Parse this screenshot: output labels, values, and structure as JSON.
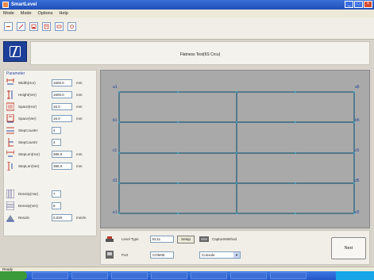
{
  "window": {
    "title": "SmartLevel"
  },
  "menu": [
    "Mode",
    "Mode",
    "Options",
    "Help"
  ],
  "toolbar": {
    "icons": [
      "new-icon",
      "edit-icon",
      "save-icon",
      "export-icon",
      "print-icon",
      "settings-icon"
    ]
  },
  "header": {
    "title": "Flatness Test(6S Crcu)"
  },
  "params": {
    "title": "Parameter",
    "rows": [
      {
        "label": "Width(Hor)",
        "value": "1600.0",
        "unit": "mm"
      },
      {
        "label": "Height(Ver)",
        "value": "1600.0",
        "unit": "mm"
      },
      {
        "label": "Space(Hor)",
        "value": "16.0",
        "unit": "mm"
      },
      {
        "label": "Space(Ver)",
        "value": "16.0",
        "unit": "mm"
      },
      {
        "label": "StepCountH",
        "value": "4",
        "unit": ""
      },
      {
        "label": "StepCountV",
        "value": "4",
        "unit": ""
      },
      {
        "label": "StepLen(Hor)",
        "value": "385.0",
        "unit": "mm"
      },
      {
        "label": "StepLen(Ver)",
        "value": "385.0",
        "unit": "mm"
      },
      {
        "label": "Density(Hor)",
        "value": "7",
        "unit": ""
      },
      {
        "label": "Density(Ver)",
        "value": "8",
        "unit": ""
      },
      {
        "label": "Resoln",
        "value": "0.020",
        "unit": "mm/m"
      }
    ]
  },
  "grid": {
    "left_labels": [
      "a1",
      "b1",
      "c1",
      "d1",
      "e1"
    ],
    "right_labels": [
      "a5",
      "b5",
      "c5",
      "d5",
      "e5"
    ]
  },
  "bottom": {
    "level_type_label": "Level Type",
    "level_type_value": "EL11",
    "setup_label": "Setup",
    "capture_label": "CaptureMethod",
    "port_label": "Port",
    "port_value": "COM45",
    "capture_value": "Console",
    "next_label": "Next"
  },
  "status": {
    "text": "Ready"
  },
  "colors": {
    "title_bar": "#1f4fb8",
    "grid_line": "#1e5a78",
    "grid_bg": "#a9a9a9",
    "accent": "#2b4ba8"
  }
}
